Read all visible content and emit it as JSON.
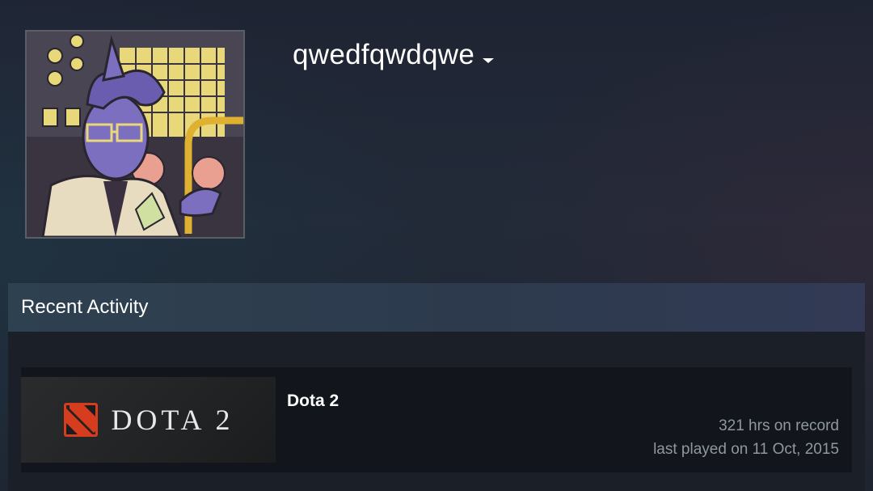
{
  "profile": {
    "persona_name": "qwedfqwdqwe",
    "avatar_icon": "avatar-illustration-icon",
    "dropdown_icon": "caret-down-icon"
  },
  "recent_activity": {
    "title": "Recent Activity",
    "games": [
      {
        "name": "Dota 2",
        "capsule_text": "DOTA 2",
        "capsule_icon": "dota-logo-icon",
        "hours": "321 hrs on record",
        "last_played": "last played on 11 Oct, 2015"
      }
    ]
  },
  "colors": {
    "background": "#1f2433",
    "panel_header": "#2e4150",
    "panel_body": "#1b1f28",
    "game_row": "#12151b",
    "muted_text": "#8f98a0",
    "dota_red": "#d63d1f"
  }
}
